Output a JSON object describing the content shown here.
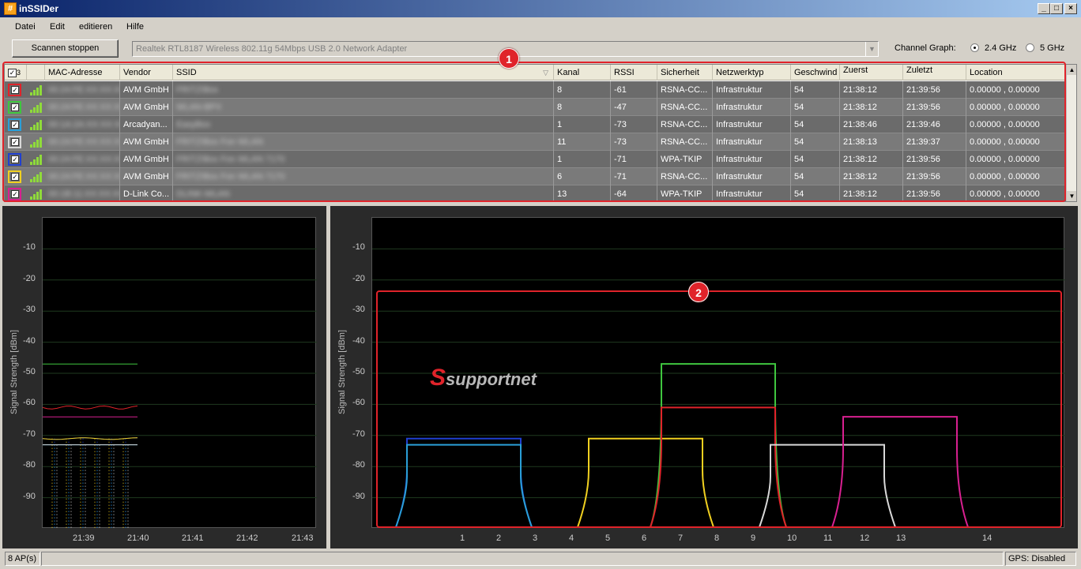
{
  "window": {
    "title": "inSSIDer",
    "app_icon": "hash-icon"
  },
  "menu": [
    "Datei",
    "Edit",
    "editieren",
    "Hilfe"
  ],
  "toolbar": {
    "scan_button": "Scannen stoppen",
    "adapter": "Realtek RTL8187 Wireless 802.11g 54Mbps USB 2.0 Network Adapter",
    "channel_graph_label": "Channel Graph:",
    "options": [
      "2.4 GHz",
      "5 GHz"
    ],
    "selected": "2.4 GHz"
  },
  "table": {
    "select_all_count": "3",
    "columns": [
      "MAC-Adresse",
      "Vendor",
      "SSID",
      "Kanal",
      "RSSI",
      "Sicherheit",
      "Netzwerktyp",
      "Geschwind",
      "Zuerst",
      "Zuletzt",
      "Location"
    ],
    "rows": [
      {
        "color": "#e0232a",
        "mac": "00:24:FE:XX:XX:XX",
        "vendor": "AVM GmbH",
        "ssid": "FRITZ!Box",
        "kanal": "8",
        "rssi": "-61",
        "sicherheit": "RSNA-CC...",
        "netzwerktyp": "Infrastruktur",
        "geschwind": "54",
        "zuerst": "21:38:12",
        "zuletzt": "21:39:56",
        "location": "0.00000 , 0.00000"
      },
      {
        "color": "#3fc63f",
        "mac": "00:24:FE:XX:XX:XX",
        "vendor": "AVM GmbH",
        "ssid": "WLAN-BPX",
        "kanal": "8",
        "rssi": "-47",
        "sicherheit": "RSNA-CC...",
        "netzwerktyp": "Infrastruktur",
        "geschwind": "54",
        "zuerst": "21:38:12",
        "zuletzt": "21:39:56",
        "location": "0.00000 , 0.00000"
      },
      {
        "color": "#2a9fd8",
        "mac": "00:1A:2A:XX:XX:XX",
        "vendor": "Arcadyan...",
        "ssid": "EasyBox",
        "kanal": "1",
        "rssi": "-73",
        "sicherheit": "RSNA-CC...",
        "netzwerktyp": "Infrastruktur",
        "geschwind": "54",
        "zuerst": "21:38:46",
        "zuletzt": "21:39:46",
        "location": "0.00000 , 0.00000"
      },
      {
        "color": "#d8d8d8",
        "mac": "00:24:FE:XX:XX:XX",
        "vendor": "AVM GmbH",
        "ssid": "FRITZ!Box Fon WLAN",
        "kanal": "11",
        "rssi": "-73",
        "sicherheit": "RSNA-CC...",
        "netzwerktyp": "Infrastruktur",
        "geschwind": "54",
        "zuerst": "21:38:13",
        "zuletzt": "21:39:37",
        "location": "0.00000 , 0.00000"
      },
      {
        "color": "#2040d0",
        "mac": "00:24:FE:XX:XX:XX",
        "vendor": "AVM GmbH",
        "ssid": "FRITZ!Box Fon WLAN 7170",
        "kanal": "1",
        "rssi": "-71",
        "sicherheit": "WPA-TKIP",
        "netzwerktyp": "Infrastruktur",
        "geschwind": "54",
        "zuerst": "21:38:12",
        "zuletzt": "21:39:56",
        "location": "0.00000 , 0.00000"
      },
      {
        "color": "#f0d020",
        "mac": "00:24:FE:XX:XX:XX",
        "vendor": "AVM GmbH",
        "ssid": "FRITZ!Box Fon WLAN 7170",
        "kanal": "6",
        "rssi": "-71",
        "sicherheit": "RSNA-CC...",
        "netzwerktyp": "Infrastruktur",
        "geschwind": "54",
        "zuerst": "21:38:12",
        "zuletzt": "21:39:56",
        "location": "0.00000 , 0.00000"
      },
      {
        "color": "#d82090",
        "mac": "00:1B:11:XX:XX:XX",
        "vendor": "D-Link Co...",
        "ssid": "DLINK-WLAN",
        "kanal": "13",
        "rssi": "-64",
        "sicherheit": "WPA-TKIP",
        "netzwerktyp": "Infrastruktur",
        "geschwind": "54",
        "zuerst": "21:38:12",
        "zuletzt": "21:39:56",
        "location": "0.00000 , 0.00000"
      }
    ]
  },
  "annotations": [
    "1",
    "2"
  ],
  "time_graph": {
    "ylabel": "Signal Strength [dBm]",
    "yticks": [
      "-10",
      "-20",
      "-30",
      "-40",
      "-50",
      "-60",
      "-70",
      "-80",
      "-90"
    ],
    "xticks": [
      "21:39",
      "21:40",
      "21:41",
      "21:42",
      "21:43"
    ]
  },
  "channel_graph": {
    "ylabel": "Signal Strength [dBm]",
    "yticks": [
      "-10",
      "-20",
      "-30",
      "-40",
      "-50",
      "-60",
      "-70",
      "-80",
      "-90"
    ],
    "xticks": [
      "1",
      "2",
      "3",
      "4",
      "5",
      "6",
      "7",
      "8",
      "9",
      "10",
      "11",
      "12",
      "13",
      "14"
    ],
    "watermark": "supportnet",
    "networks": [
      {
        "channel": 1,
        "rssi": -71,
        "color": "#2040d0"
      },
      {
        "channel": 1,
        "rssi": -73,
        "color": "#2a9fd8"
      },
      {
        "channel": 6,
        "rssi": -71,
        "color": "#f0d020"
      },
      {
        "channel": 8,
        "rssi": -47,
        "color": "#3fc63f"
      },
      {
        "channel": 8,
        "rssi": -61,
        "color": "#e0232a"
      },
      {
        "channel": 11,
        "rssi": -73,
        "color": "#d8d8d8"
      },
      {
        "channel": 13,
        "rssi": -64,
        "color": "#d82090"
      }
    ]
  },
  "status": {
    "ap_count": "8 AP(s)",
    "gps": "GPS: Disabled"
  }
}
